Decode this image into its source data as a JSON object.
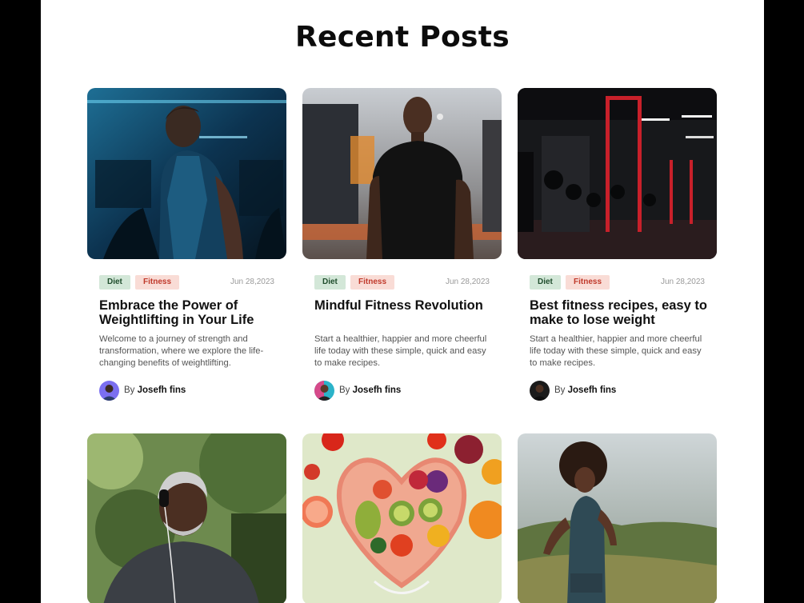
{
  "page": {
    "title": "Recent Posts"
  },
  "posts": [
    {
      "image": "man-in-blue-lit-gym-photo",
      "tags": [
        "Diet",
        "Fitness"
      ],
      "date": "Jun 28,2023",
      "title": "Embrace the Power of Weightlifting in Your Life",
      "excerpt": "Welcome to a journey of strength and transformation, where we explore the life-changing benefits of weightlifting.",
      "by": "By",
      "author": "Josefh fins"
    },
    {
      "image": "man-in-black-tshirt-photo",
      "tags": [
        "Diet",
        "Fitness"
      ],
      "date": "Jun 28,2023",
      "title": "Mindful Fitness Revolution",
      "excerpt": "Start a healthier, happier and more cheerful life today with these simple, quick and easy to make recipes.",
      "by": "By",
      "author": "Josefh fins"
    },
    {
      "image": "dark-gym-red-racks-photo",
      "tags": [
        "Diet",
        "Fitness"
      ],
      "date": "Jun 28,2023",
      "title": "Best fitness recipes, easy to make to lose weight",
      "excerpt": "Start a healthier, happier and more cheerful life today with these simple, quick and easy to make recipes.",
      "by": "By",
      "author": "Josefh fins"
    },
    {
      "image": "older-man-jogging-with-earphones-photo"
    },
    {
      "image": "heart-shaped-fruit-bowl-photo"
    },
    {
      "image": "woman-running-in-field-photo"
    }
  ],
  "colors": {
    "diet_tag_bg": "#d3e7d8",
    "fitness_tag_bg": "#f9dcd6",
    "fitness_tag_text": "#c0392b"
  }
}
